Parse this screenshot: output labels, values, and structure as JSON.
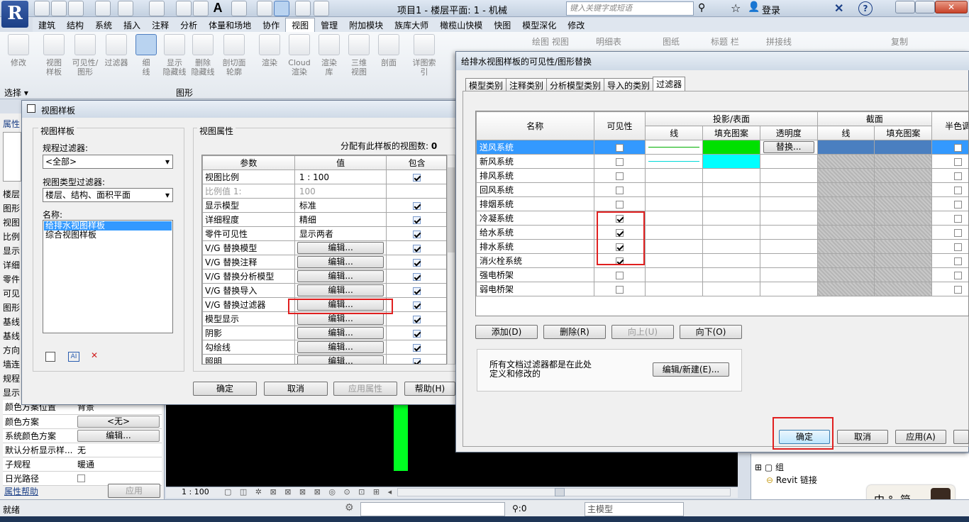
{
  "app": {
    "title": "项目1 - 楼层平面: 1 - 机械",
    "search_placeholder": "键入关键字或短语",
    "login": "登录",
    "ribbon_tabs": [
      "建筑",
      "结构",
      "系统",
      "插入",
      "注释",
      "分析",
      "体量和场地",
      "协作",
      "视图",
      "管理",
      "附加模块",
      "族库大师",
      "橄榄山快模",
      "快图",
      "模型深化",
      "修改"
    ],
    "active_tab": "视图",
    "ribbon_buttons": [
      {
        "label": "修改"
      },
      {
        "label": "视图\n样板"
      },
      {
        "label": "可见性/\n图形"
      },
      {
        "label": "过滤器"
      },
      {
        "label": "细\n线"
      },
      {
        "label": "显示\n隐藏线"
      },
      {
        "label": "删除\n隐藏线"
      },
      {
        "label": "剖切面\n轮廓"
      },
      {
        "label": "渲染"
      },
      {
        "label": "Cloud\n渲染"
      },
      {
        "label": "渲染\n库"
      },
      {
        "label": "三维\n视图"
      },
      {
        "label": "剖面"
      },
      {
        "label": "详图索引"
      }
    ],
    "ribbon_small": [
      "绘图 视图",
      "明细表",
      "图纸",
      "标题 栏",
      "拼接线",
      "复制"
    ],
    "panel_select": "选择",
    "panel_graphics": "图形",
    "status_text": "就绪",
    "status_zero": ":0",
    "status_model": "主模型",
    "view_scale": "1 : 100",
    "project_browser": {
      "group": "组",
      "revit_link": "Revit 链接"
    },
    "ime": {
      "zh": "中",
      "simp": "简"
    }
  },
  "properties": {
    "header": "属性",
    "items_partial": [
      "楼层",
      "图形",
      "视图",
      "比例",
      "显示",
      "详细",
      "零件",
      "可见",
      "图形",
      "基线",
      "基线",
      "方向",
      "墙连",
      "规程",
      "显示"
    ],
    "rows": [
      {
        "label": "颜色方案位置",
        "value": "背景"
      },
      {
        "label": "颜色方案",
        "value": "<无>"
      },
      {
        "label": "系统颜色方案",
        "value": "编辑..."
      },
      {
        "label": "默认分析显示样...",
        "value": "无"
      },
      {
        "label": "子规程",
        "value": "暖通"
      },
      {
        "label": "日光路径",
        "value": ""
      }
    ],
    "help_link": "属性帮助",
    "apply": "应用"
  },
  "view_templates_dialog": {
    "title": "视图样板",
    "left_group": "视图样板",
    "discipline_label": "规程过滤器:",
    "discipline_value": "<全部>",
    "viewtype_label": "视图类型过滤器:",
    "viewtype_value": "楼层、结构、面积平面",
    "names_label": "名称:",
    "names": [
      "给排水视图样板",
      "综合视图样板"
    ],
    "selected_name": "给排水视图样板",
    "right_group": "视图属性",
    "assigned_count_label": "分配有此样板的视图数:",
    "assigned_count": "0",
    "columns": [
      "参数",
      "值",
      "包含"
    ],
    "rows": [
      {
        "param": "视图比例",
        "value": "1 : 100",
        "button": false,
        "include": true,
        "grey": false
      },
      {
        "param": "比例值 1:",
        "value": "100",
        "button": false,
        "include": null,
        "grey": true
      },
      {
        "param": "显示模型",
        "value": "标准",
        "button": false,
        "include": true,
        "grey": false
      },
      {
        "param": "详细程度",
        "value": "精细",
        "button": false,
        "include": true,
        "grey": false
      },
      {
        "param": "零件可见性",
        "value": "显示两者",
        "button": false,
        "include": true,
        "grey": false
      },
      {
        "param": "V/G 替换模型",
        "value": "编辑...",
        "button": true,
        "include": true,
        "grey": false
      },
      {
        "param": "V/G 替换注释",
        "value": "编辑...",
        "button": true,
        "include": true,
        "grey": false
      },
      {
        "param": "V/G 替换分析模型",
        "value": "编辑...",
        "button": true,
        "include": true,
        "grey": false
      },
      {
        "param": "V/G 替换导入",
        "value": "编辑...",
        "button": true,
        "include": true,
        "grey": false
      },
      {
        "param": "V/G 替换过滤器",
        "value": "编辑...",
        "button": true,
        "include": true,
        "grey": false
      },
      {
        "param": "模型显示",
        "value": "编辑...",
        "button": true,
        "include": true,
        "grey": false
      },
      {
        "param": "阴影",
        "value": "编辑...",
        "button": true,
        "include": true,
        "grey": false
      },
      {
        "param": "勾绘线",
        "value": "编辑...",
        "button": true,
        "include": true,
        "grey": false
      },
      {
        "param": "照明",
        "value": "编辑...",
        "button": true,
        "include": true,
        "grey": false
      }
    ],
    "ok": "确定",
    "cancel": "取消",
    "apply": "应用属性",
    "help": "帮助(H)"
  },
  "vg_dialog": {
    "title": "给排水视图样板的可见性/图形替换",
    "tabs": [
      "模型类别",
      "注释类别",
      "分析模型类别",
      "导入的类别",
      "过滤器"
    ],
    "active_tab": "过滤器",
    "col_name": "名称",
    "col_visibility": "可见性",
    "group_projection": "投影/表面",
    "group_cut": "截面",
    "sub_line": "线",
    "sub_fill": "填充图案",
    "sub_transparency": "透明度",
    "col_halftone": "半色调",
    "rows": [
      {
        "name": "送风系统",
        "visible": false,
        "line_color": "#00b000",
        "fill_color": "#00e000",
        "transparency": "替换...",
        "selected": true
      },
      {
        "name": "新风系统",
        "visible": false,
        "line_color": "#00d8d8",
        "fill_color": "#00ffff",
        "transparency": "",
        "selected": false
      },
      {
        "name": "排风系统",
        "visible": false,
        "line_color": "",
        "fill_color": "",
        "transparency": "",
        "selected": false
      },
      {
        "name": "回风系统",
        "visible": false,
        "line_color": "",
        "fill_color": "",
        "transparency": "",
        "selected": false
      },
      {
        "name": "排烟系统",
        "visible": false,
        "line_color": "",
        "fill_color": "",
        "transparency": "",
        "selected": false
      },
      {
        "name": "冷凝系统",
        "visible": true,
        "line_color": "",
        "fill_color": "",
        "transparency": "",
        "selected": false
      },
      {
        "name": "给水系统",
        "visible": true,
        "line_color": "",
        "fill_color": "",
        "transparency": "",
        "selected": false
      },
      {
        "name": "排水系统",
        "visible": true,
        "line_color": "",
        "fill_color": "",
        "transparency": "",
        "selected": false
      },
      {
        "name": "消火栓系统",
        "visible": true,
        "line_color": "",
        "fill_color": "",
        "transparency": "",
        "selected": false
      },
      {
        "name": "强电桥架",
        "visible": false,
        "line_color": "",
        "fill_color": "",
        "transparency": "",
        "selected": false
      },
      {
        "name": "弱电桥架",
        "visible": false,
        "line_color": "",
        "fill_color": "",
        "transparency": "",
        "selected": false
      }
    ],
    "add": "添加(D)",
    "remove": "删除(R)",
    "up": "向上(U)",
    "down": "向下(O)",
    "info": "所有文档过滤器都是在此处定义和修改的",
    "edit_new": "编辑/新建(E)...",
    "ok": "确定",
    "cancel": "取消",
    "apply": "应用(A)"
  }
}
